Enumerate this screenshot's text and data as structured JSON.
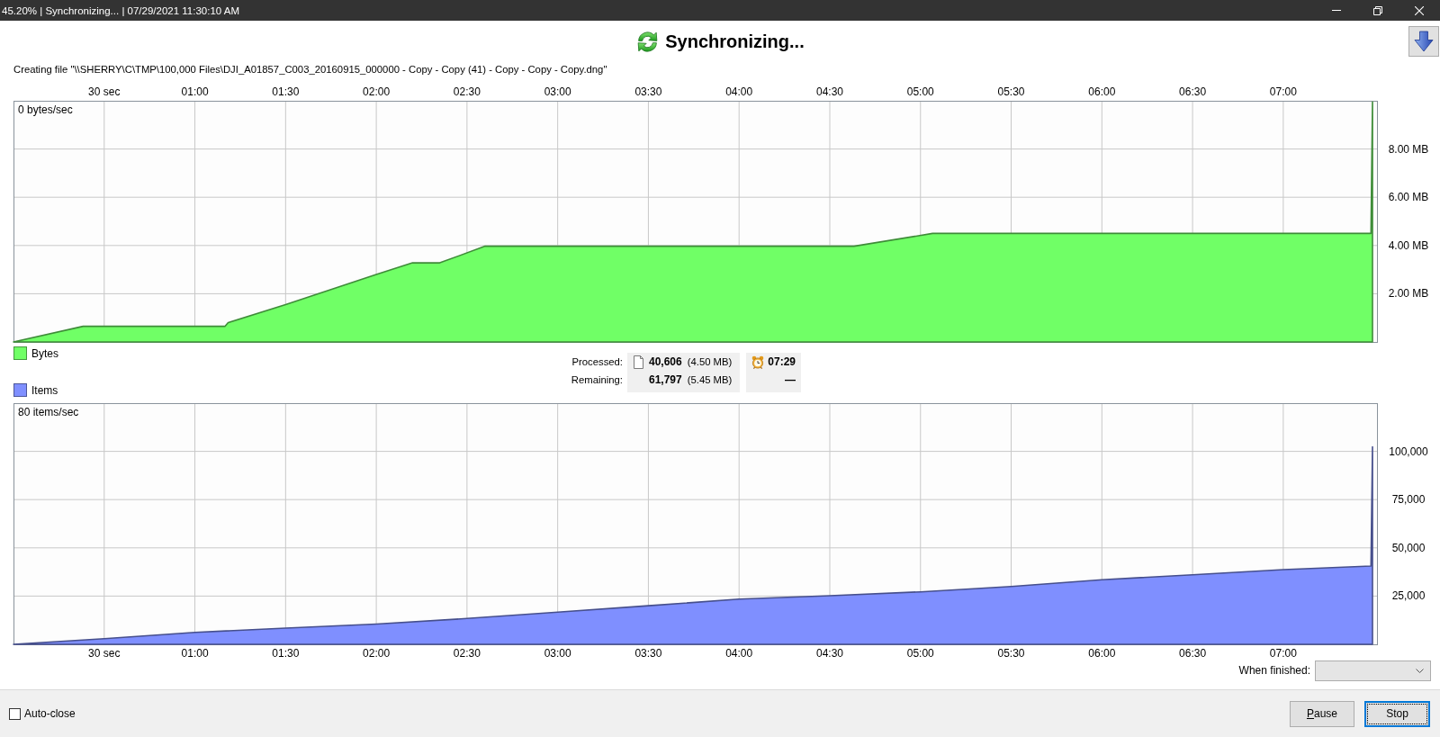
{
  "window": {
    "title": "45.20% | Synchronizing... | 07/29/2021 11:30:10 AM"
  },
  "header": {
    "title": "Synchronizing...",
    "status_line": "Creating file \"\\\\SHERRY\\C\\TMP\\100,000 Files\\DJI_A01857_C003_20160915_000000 - Copy - Copy (41) - Copy - Copy - Copy.dng\""
  },
  "bytes_chart": {
    "rate_label": "0 bytes/sec",
    "chart_data": {
      "type": "area",
      "x": [
        0,
        23,
        70,
        71,
        90,
        120,
        132,
        141,
        156,
        278,
        304,
        449,
        449.5
      ],
      "series": [
        {
          "name": "Bytes",
          "color": "#70ff66",
          "values": [
            0,
            0.65,
            0.65,
            0.8,
            1.55,
            2.8,
            3.28,
            3.28,
            3.97,
            3.97,
            4.5,
            4.5,
            9.95
          ]
        }
      ],
      "xlim": [
        0,
        451
      ],
      "ylim": [
        0,
        10
      ],
      "grid": true,
      "xticks": [
        {
          "value": 30,
          "label": "30 sec"
        },
        {
          "value": 60,
          "label": "01:00"
        },
        {
          "value": 90,
          "label": "01:30"
        },
        {
          "value": 120,
          "label": "02:00"
        },
        {
          "value": 150,
          "label": "02:30"
        },
        {
          "value": 180,
          "label": "03:00"
        },
        {
          "value": 210,
          "label": "03:30"
        },
        {
          "value": 240,
          "label": "04:00"
        },
        {
          "value": 270,
          "label": "04:30"
        },
        {
          "value": 300,
          "label": "05:00"
        },
        {
          "value": 330,
          "label": "05:30"
        },
        {
          "value": 360,
          "label": "06:00"
        },
        {
          "value": 390,
          "label": "06:30"
        },
        {
          "value": 420,
          "label": "07:00"
        }
      ],
      "yticks": [
        {
          "value": 8,
          "label": "8.00 MB"
        },
        {
          "value": 6,
          "label": "6.00 MB"
        },
        {
          "value": 4,
          "label": "4.00 MB"
        },
        {
          "value": 2,
          "label": "2.00 MB"
        }
      ]
    }
  },
  "stats": {
    "rows": [
      {
        "label": "Processed:",
        "count": "40,606",
        "size": "(4.50 MB)"
      },
      {
        "label": "Remaining:",
        "count": "61,797",
        "size": "(5.45 MB)"
      }
    ],
    "time": {
      "elapsed": "07:29",
      "remaining": "—"
    }
  },
  "items_chart": {
    "rate_label": "80 items/sec",
    "chart_data": {
      "type": "area",
      "x": [
        0,
        30,
        60,
        90,
        120,
        150,
        180,
        210,
        240,
        270,
        300,
        330,
        360,
        390,
        420,
        449,
        449.5
      ],
      "series": [
        {
          "name": "Items",
          "color": "#7f8fff",
          "values": [
            0,
            2900,
            6200,
            8400,
            10500,
            13400,
            16700,
            20000,
            23400,
            25200,
            27200,
            30000,
            33500,
            36000,
            38700,
            40600,
            102400
          ]
        }
      ],
      "xlim": [
        0,
        451
      ],
      "ylim": [
        0,
        125000
      ],
      "grid": true,
      "xticks": [
        {
          "value": 30,
          "label": "30 sec"
        },
        {
          "value": 60,
          "label": "01:00"
        },
        {
          "value": 90,
          "label": "01:30"
        },
        {
          "value": 120,
          "label": "02:00"
        },
        {
          "value": 150,
          "label": "02:30"
        },
        {
          "value": 180,
          "label": "03:00"
        },
        {
          "value": 210,
          "label": "03:30"
        },
        {
          "value": 240,
          "label": "04:00"
        },
        {
          "value": 270,
          "label": "04:30"
        },
        {
          "value": 300,
          "label": "05:00"
        },
        {
          "value": 330,
          "label": "05:30"
        },
        {
          "value": 360,
          "label": "06:00"
        },
        {
          "value": 390,
          "label": "06:30"
        },
        {
          "value": 420,
          "label": "07:00"
        }
      ],
      "yticks": [
        {
          "value": 100000,
          "label": "100,000"
        },
        {
          "value": 75000,
          "label": "75,000"
        },
        {
          "value": 50000,
          "label": "50,000"
        },
        {
          "value": 25000,
          "label": "25,000"
        }
      ]
    }
  },
  "when_finished": {
    "label": "When finished:"
  },
  "auto_close": {
    "label": "Auto-close",
    "checked": false
  },
  "buttons": [
    {
      "label": "Pause",
      "focused": false,
      "mnemonic_underlined": true
    },
    {
      "label": "Stop",
      "focused": true,
      "mnemonic_underlined": false
    }
  ]
}
